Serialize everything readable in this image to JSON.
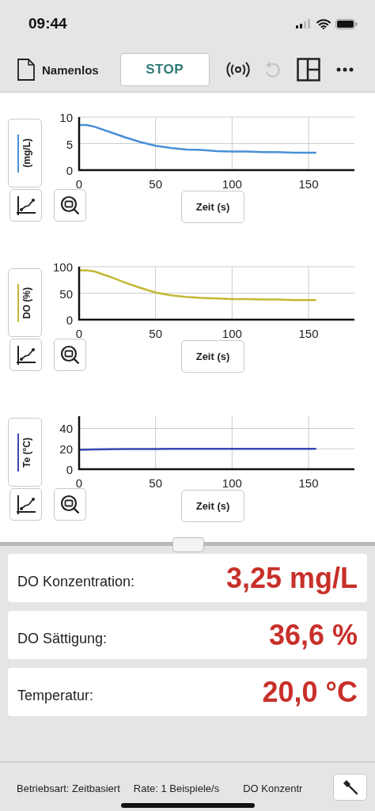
{
  "status_bar": {
    "time": "09:44"
  },
  "toolbar": {
    "file_name": "Namenlos",
    "stop_button": "STOP",
    "undo": {
      "disabled": true
    }
  },
  "graphs": [
    {
      "x_axis_button": "Zeit (s)",
      "chart_data": {
        "type": "line",
        "grid": true,
        "x": [
          0,
          5,
          10,
          20,
          30,
          40,
          50,
          60,
          70,
          80,
          90,
          100,
          110,
          120,
          130,
          140,
          150,
          155
        ],
        "series": [
          {
            "name": "(mg/L)",
            "color": "#4a8fd6",
            "values": [
              8.5,
              8.5,
              8.2,
              7.2,
              6.2,
              5.3,
              4.6,
              4.2,
              3.9,
              3.8,
              3.6,
              3.5,
              3.5,
              3.4,
              3.4,
              3.3,
              3.3,
              3.3
            ]
          }
        ],
        "xlim": [
          0,
          180
        ],
        "ylim": [
          0,
          10
        ],
        "xticks": [
          0,
          50,
          100,
          150
        ],
        "yticks": [
          0,
          5,
          10
        ]
      }
    },
    {
      "x_axis_button": "Zeit (s)",
      "chart_data": {
        "type": "line",
        "grid": true,
        "x": [
          0,
          5,
          10,
          20,
          30,
          40,
          50,
          60,
          70,
          80,
          90,
          100,
          110,
          120,
          130,
          140,
          150,
          155
        ],
        "series": [
          {
            "name": "DO (%)",
            "color": "#c2b834",
            "values": [
              93,
              93,
              91,
              81,
              70,
              60,
              51,
              46,
              43,
              41,
              40,
              39,
              39,
              38,
              38,
              37,
              37,
              37
            ]
          }
        ],
        "xlim": [
          0,
          180
        ],
        "ylim": [
          0,
          100
        ],
        "xticks": [
          0,
          50,
          100,
          150
        ],
        "yticks": [
          0,
          50,
          100
        ]
      }
    },
    {
      "x_axis_button": "Zeit (s)",
      "chart_data": {
        "type": "line",
        "grid": true,
        "x": [
          0,
          5,
          10,
          20,
          30,
          40,
          50,
          60,
          70,
          80,
          90,
          100,
          110,
          120,
          130,
          140,
          150,
          155
        ],
        "series": [
          {
            "name": "Te (°C)",
            "color": "#3a48b0",
            "values": [
              19,
              19.2,
              19.4,
              19.6,
              19.7,
              19.8,
              19.9,
              20,
              20,
              20,
              20,
              20,
              20,
              20,
              20,
              20,
              20,
              20
            ]
          }
        ],
        "xlim": [
          0,
          180
        ],
        "ylim": [
          0,
          52
        ],
        "xticks": [
          0,
          50,
          100,
          150
        ],
        "yticks": [
          0,
          20,
          40
        ]
      }
    }
  ],
  "meters": [
    {
      "label": "DO Konzentration:",
      "value": "3,25 mg/L"
    },
    {
      "label": "DO Sättigung:",
      "value": "36,6 %"
    },
    {
      "label": "Temperatur:",
      "value": "20,0 °C"
    }
  ],
  "footer": {
    "mode": "Betriebsart: Zeitbasiert",
    "rate": "Rate: 1 Beispiele/s",
    "sensor": "DO Konzentr"
  }
}
